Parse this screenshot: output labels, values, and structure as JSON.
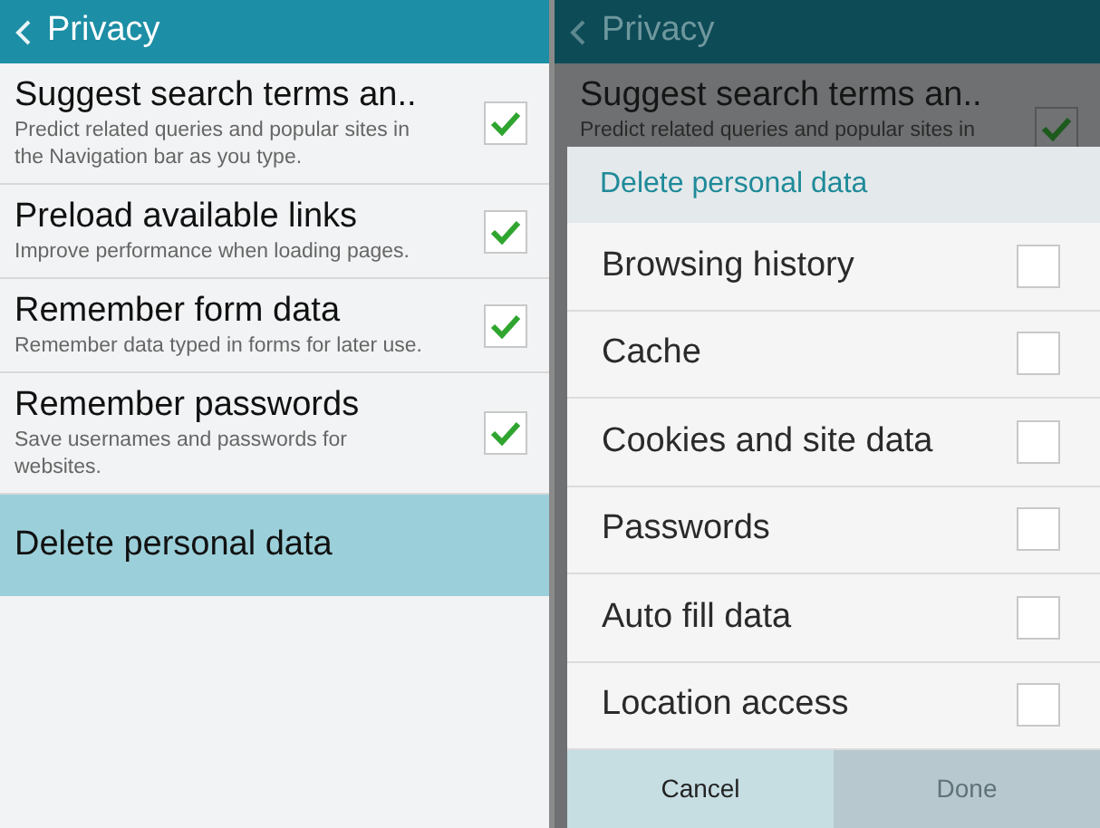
{
  "settings_screen": {
    "title": "Privacy",
    "items": [
      {
        "label": "Suggest search terms an..",
        "description": "Predict related queries and popular sites in the Navigation bar as you type.",
        "checked": true
      },
      {
        "label": "Preload available links",
        "description": "Improve performance when loading pages.",
        "checked": true
      },
      {
        "label": "Remember form data",
        "description": "Remember data typed in forms for later use.",
        "checked": true
      },
      {
        "label": "Remember passwords",
        "description": "Save usernames and passwords for websites.",
        "checked": true
      }
    ],
    "action": {
      "label": "Delete personal data",
      "selected": true
    }
  },
  "dimmed_screen": {
    "title": "Privacy",
    "item": {
      "label": "Suggest search terms an..",
      "description": "Predict related queries and popular sites in",
      "checked": true
    }
  },
  "dialog": {
    "title": "Delete personal data",
    "options": [
      {
        "label": "Browsing history",
        "checked": false
      },
      {
        "label": "Cache",
        "checked": false
      },
      {
        "label": "Cookies and site data",
        "checked": false
      },
      {
        "label": "Passwords",
        "checked": false
      },
      {
        "label": "Auto fill data",
        "checked": false
      },
      {
        "label": "Location access",
        "checked": false
      }
    ],
    "buttons": [
      {
        "label": "Cancel",
        "disabled": false
      },
      {
        "label": "Done",
        "disabled": true
      }
    ]
  }
}
